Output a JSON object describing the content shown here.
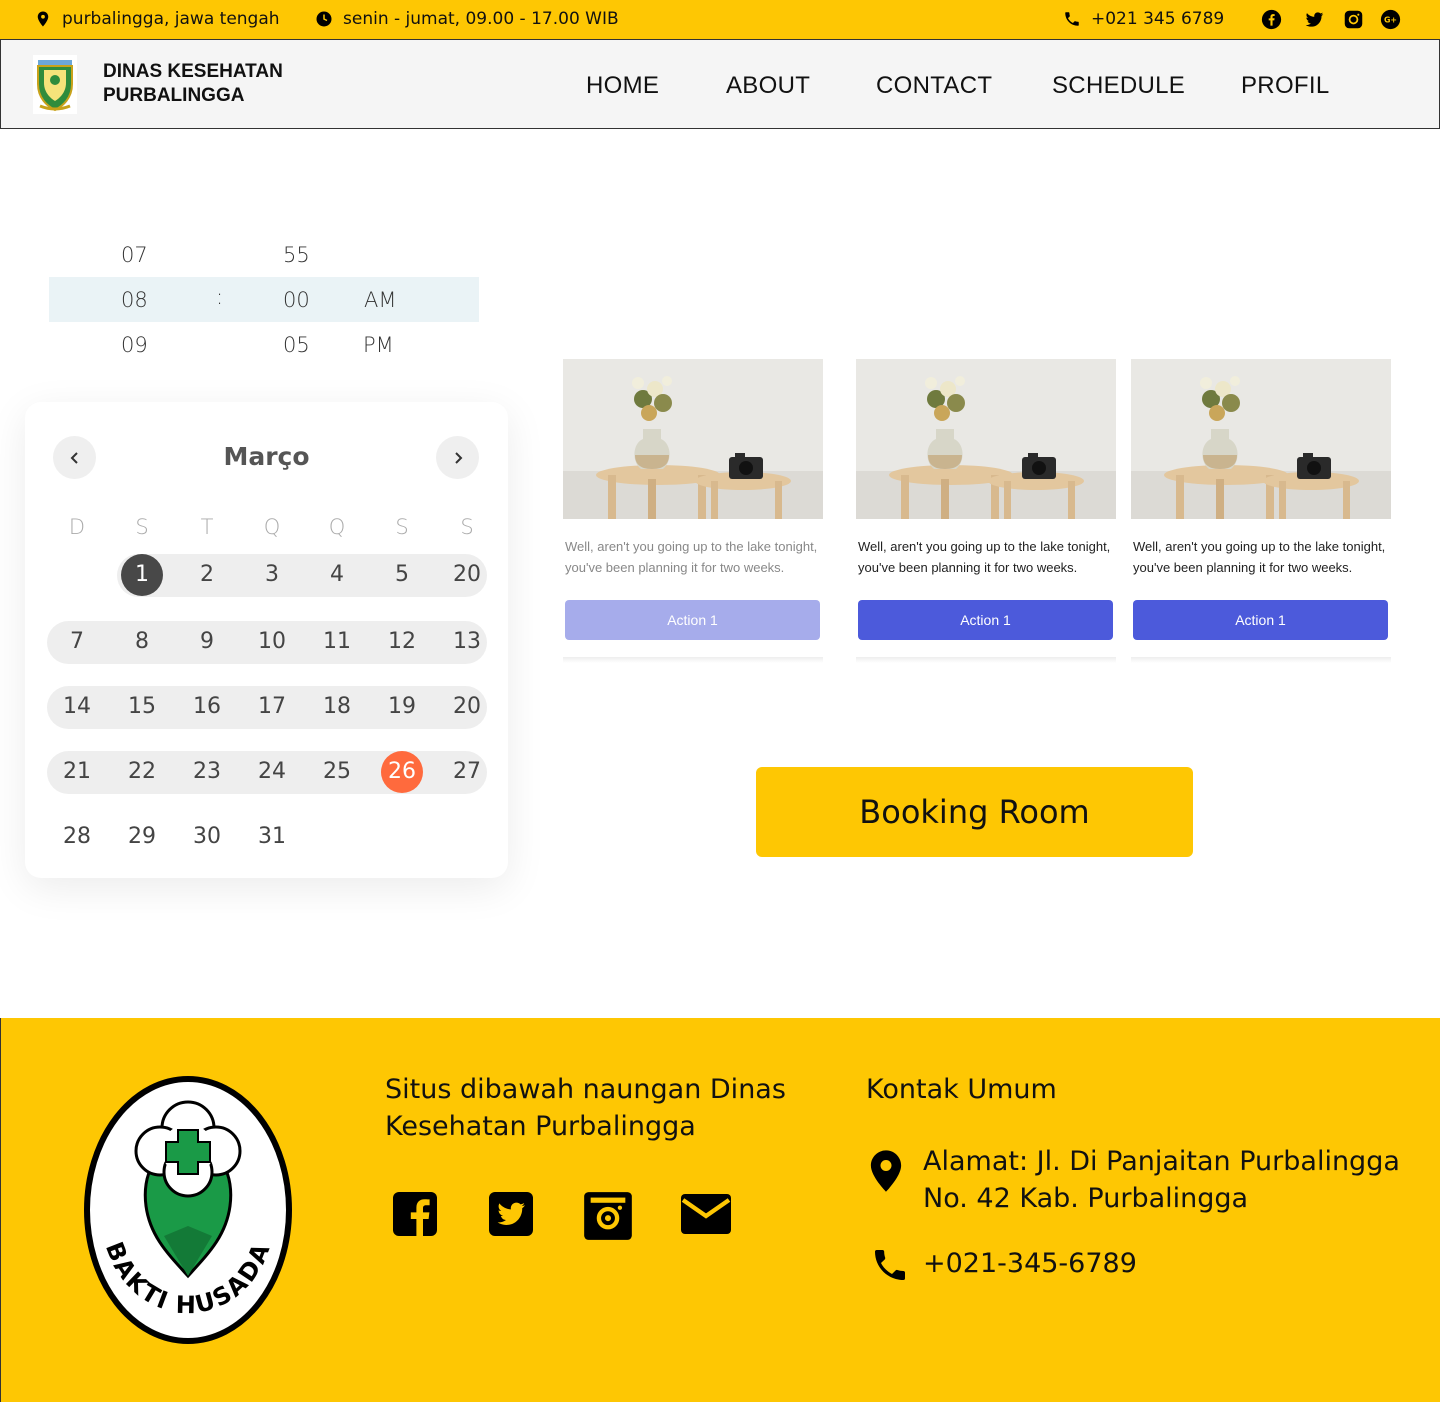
{
  "topbar": {
    "location": "purbalingga,  jawa tengah",
    "hours": "senin - jumat, 09.00 - 17.00 WIB",
    "phone": "+021 345 6789",
    "social_icons": [
      "facebook-icon",
      "twitter-icon",
      "instagram-icon",
      "google-plus-icon"
    ],
    "background": "#FEC703"
  },
  "header": {
    "brand_line1": "DINAS KESEHATAN",
    "brand_line2": "PURBALINGGA",
    "nav": [
      "HOME",
      "ABOUT",
      "CONTACT",
      "SCHEDULE",
      "PROFIL"
    ]
  },
  "timepicker": {
    "hours": [
      "07",
      "08",
      "09"
    ],
    "separator": ":",
    "minutes": [
      "55",
      "00",
      "05"
    ],
    "periods": [
      "",
      "AM",
      "PM"
    ],
    "selected_row": 1
  },
  "calendar": {
    "month": "Março",
    "weekdays": [
      "D",
      "S",
      "T",
      "Q",
      "Q",
      "S",
      "S"
    ],
    "weeks": [
      [
        "",
        "1",
        "2",
        "3",
        "4",
        "5",
        "20"
      ],
      [
        "7",
        "8",
        "9",
        "10",
        "11",
        "12",
        "13"
      ],
      [
        "14",
        "15",
        "16",
        "17",
        "18",
        "19",
        "20"
      ],
      [
        "21",
        "22",
        "23",
        "24",
        "25",
        "26",
        "27"
      ],
      [
        "28",
        "29",
        "30",
        "31",
        "",
        "",
        ""
      ]
    ],
    "today": "1",
    "highlighted": "26",
    "accent": "#FF6A3D"
  },
  "cards": [
    {
      "text": "Well, aren't you going up to the lake tonight, you've been planning it for two weeks.",
      "button": "Action 1",
      "state": "disabled"
    },
    {
      "text": "Well, aren't you going up to the lake tonight, you've been planning it for two weeks.",
      "button": "Action 1",
      "state": "active"
    },
    {
      "text": "Well, aren't you going up to the lake tonight, you've been planning it for two weeks.",
      "button": "Action 1",
      "state": "active"
    }
  ],
  "booking": {
    "label": "Booking Room"
  },
  "footer": {
    "tagline_line1": "Situs dibawah naungan Dinas",
    "tagline_line2": "Kesehatan Purbalingga",
    "logo_text": "BAKTI HUSADA",
    "social_icons": [
      "facebook-icon",
      "twitter-icon",
      "instagram-icon",
      "mail-icon"
    ],
    "contact_title": "Kontak Umum",
    "address_line1": "Alamat: Jl. Di Panjaitan Purbalingga",
    "address_line2": "No. 42 Kab. Purbalingga",
    "phone": "+021-345-6789"
  }
}
